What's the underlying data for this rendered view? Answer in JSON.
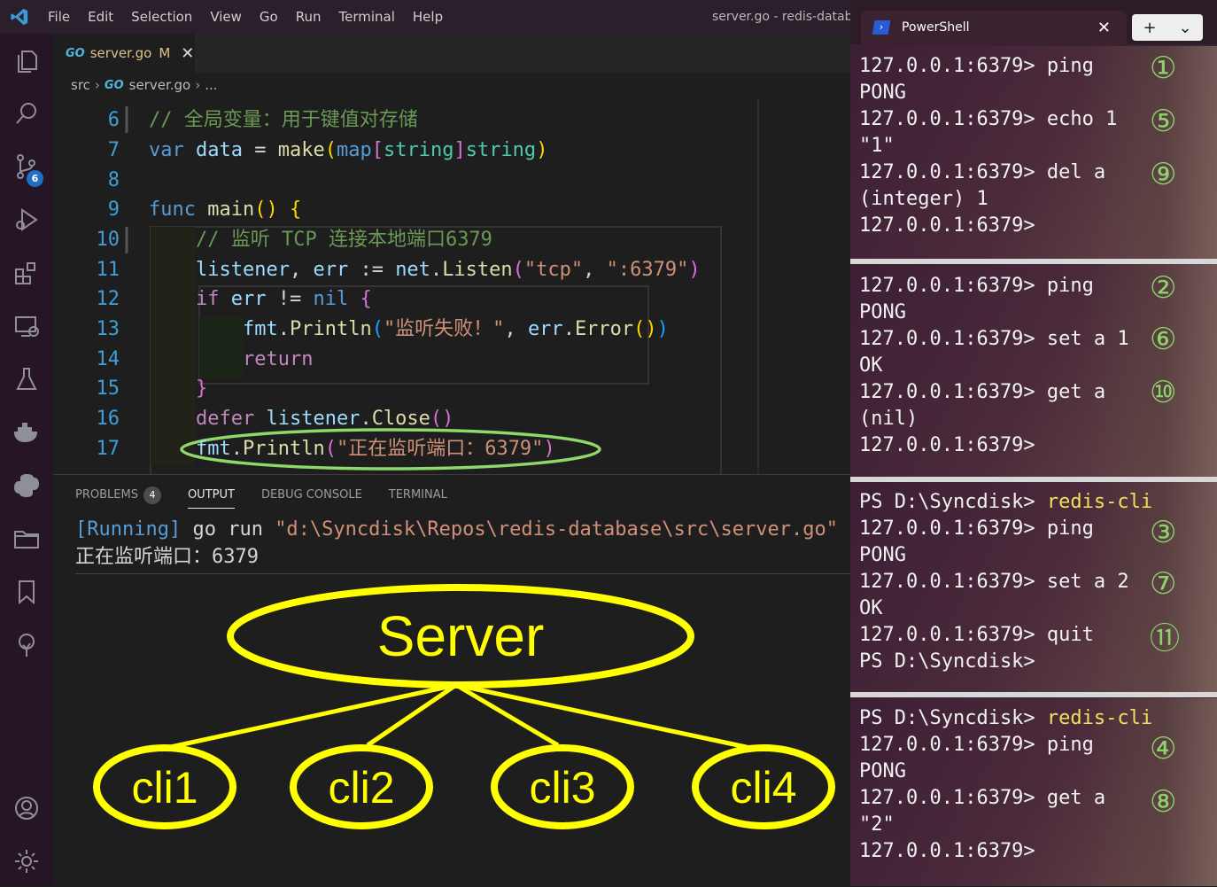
{
  "titlebar": {
    "menu": [
      "File",
      "Edit",
      "Selection",
      "View",
      "Go",
      "Run",
      "Terminal",
      "Help"
    ],
    "window_title": "server.go - redis-databa"
  },
  "activity_badge": "6",
  "tab": {
    "icon": "GO",
    "filename": "server.go",
    "modified": "M",
    "close": "✕"
  },
  "breadcrumb": {
    "folder": "src",
    "icon": "GO",
    "file": "server.go",
    "more": "..."
  },
  "editor": {
    "line_numbers": [
      "6",
      "7",
      "8",
      "9",
      "10",
      "11",
      "12",
      "13",
      "14",
      "15",
      "16",
      "17"
    ],
    "comment_global": "// 全局变量：用于键值对存储",
    "comment_listen": "// 监听 TCP 连接本地端口6379",
    "str_tcp": "\"tcp\"",
    "str_port": "\":6379\"",
    "str_fail": "\"监听失败！\"",
    "str_listening": "\"正在监听端口：6379\""
  },
  "panel": {
    "tabs": [
      "PROBLEMS",
      "OUTPUT",
      "DEBUG CONSOLE",
      "TERMINAL"
    ],
    "problems_count": "4",
    "output_running": "[Running]",
    "output_cmd": " go run ",
    "output_path": "\"d:\\Syncdisk\\Repos\\redis-database\\src\\server.go\"",
    "output_line2": "正在监听端口：6379"
  },
  "diagram": {
    "server_label": "Server",
    "clients": [
      "cli1",
      "cli2",
      "cli3",
      "cli4"
    ],
    "color": "#ffff00"
  },
  "terminal": {
    "tab_title": "PowerShell",
    "tab_close": "✕",
    "plus": "+",
    "dropdown": "⌄",
    "panes": [
      {
        "lines": [
          {
            "prompt": "127.0.0.1:6379> ",
            "cmd": "ping"
          },
          {
            "prompt": "PONG",
            "cmd": ""
          },
          {
            "prompt": "127.0.0.1:6379> ",
            "cmd": "echo 1"
          },
          {
            "prompt": "\"1\"",
            "cmd": ""
          },
          {
            "prompt": "127.0.0.1:6379> ",
            "cmd": "del a"
          },
          {
            "prompt": "(integer) 1",
            "cmd": ""
          },
          {
            "prompt": "127.0.0.1:6379>",
            "cmd": ""
          }
        ],
        "marks": [
          "①",
          "⑤",
          "⑨"
        ]
      },
      {
        "lines": [
          {
            "prompt": "127.0.0.1:6379> ",
            "cmd": "ping"
          },
          {
            "prompt": "PONG",
            "cmd": ""
          },
          {
            "prompt": "127.0.0.1:6379> ",
            "cmd": "set a 1"
          },
          {
            "prompt": "OK",
            "cmd": ""
          },
          {
            "prompt": "127.0.0.1:6379> ",
            "cmd": "get a"
          },
          {
            "prompt": "(nil)",
            "cmd": ""
          },
          {
            "prompt": "127.0.0.1:6379>",
            "cmd": ""
          }
        ],
        "marks": [
          "②",
          "⑥",
          "⑩"
        ]
      },
      {
        "lines": [
          {
            "prompt": "PS D:\\Syncdisk> ",
            "cmd": "redis-cli",
            "highlight": true
          },
          {
            "prompt": "127.0.0.1:6379> ",
            "cmd": "ping"
          },
          {
            "prompt": "PONG",
            "cmd": ""
          },
          {
            "prompt": "127.0.0.1:6379> ",
            "cmd": "set a 2"
          },
          {
            "prompt": "OK",
            "cmd": ""
          },
          {
            "prompt": "127.0.0.1:6379> ",
            "cmd": "quit"
          },
          {
            "prompt": "PS D:\\Syncdisk>",
            "cmd": ""
          }
        ],
        "marks": [
          "③",
          "⑦",
          "⑪"
        ]
      },
      {
        "lines": [
          {
            "prompt": "PS D:\\Syncdisk> ",
            "cmd": "redis-cli",
            "highlight": true
          },
          {
            "prompt": "127.0.0.1:6379> ",
            "cmd": "ping"
          },
          {
            "prompt": "PONG",
            "cmd": ""
          },
          {
            "prompt": "127.0.0.1:6379> ",
            "cmd": "get a"
          },
          {
            "prompt": "\"2\"",
            "cmd": ""
          },
          {
            "prompt": "127.0.0.1:6379>",
            "cmd": ""
          }
        ],
        "marks": [
          "④",
          "⑧"
        ]
      }
    ]
  }
}
